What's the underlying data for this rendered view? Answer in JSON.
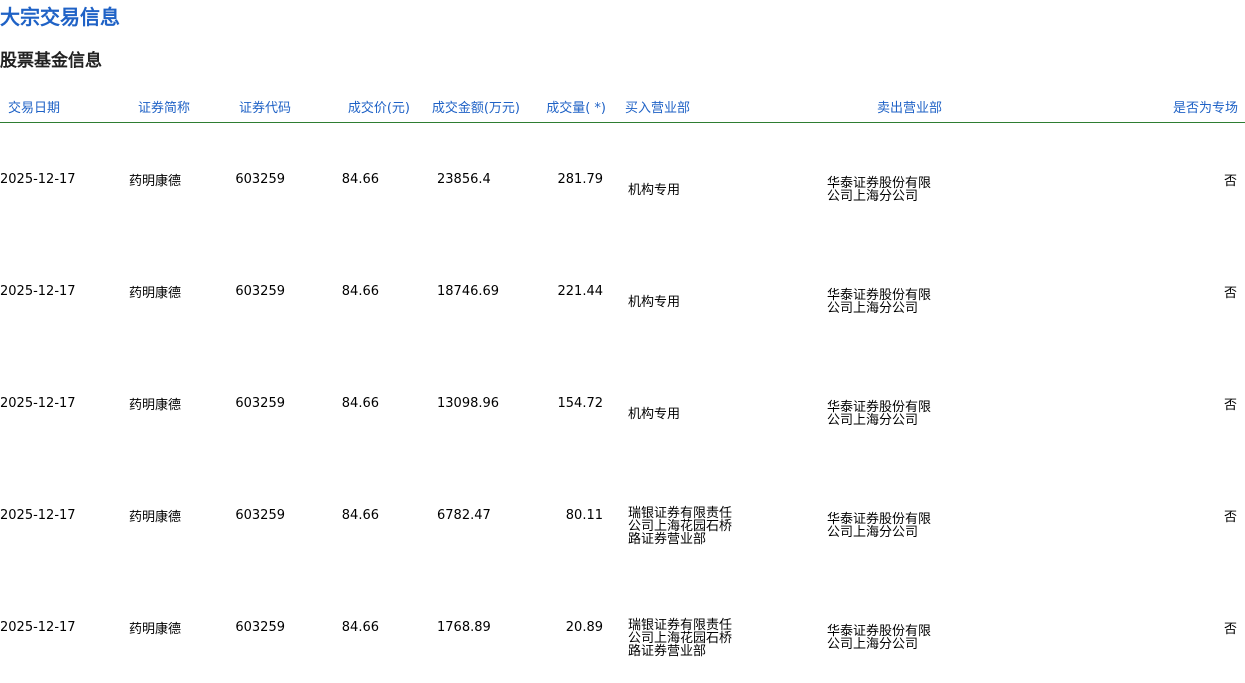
{
  "page": {
    "title": "大宗交易信息",
    "section_title": "股票基金信息"
  },
  "table": {
    "headers": {
      "date": "交易日期",
      "name": "证券简称",
      "code": "证券代码",
      "price": "成交价(元)",
      "amount": "成交金额(万元)",
      "volume": "成交量( *)",
      "buyer": "买入营业部",
      "seller": "卖出营业部",
      "special": "是否为专场"
    },
    "rows": [
      {
        "date": "2025-12-17",
        "name": "药明康德",
        "code": "603259",
        "price": "84.66",
        "amount": "23856.4",
        "volume": "281.79",
        "buyer": "机构专用",
        "seller": "华泰证券股份有限公司上海分公司",
        "special": "否"
      },
      {
        "date": "2025-12-17",
        "name": "药明康德",
        "code": "603259",
        "price": "84.66",
        "amount": "18746.69",
        "volume": "221.44",
        "buyer": "机构专用",
        "seller": "华泰证券股份有限公司上海分公司",
        "special": "否"
      },
      {
        "date": "2025-12-17",
        "name": "药明康德",
        "code": "603259",
        "price": "84.66",
        "amount": "13098.96",
        "volume": "154.72",
        "buyer": "机构专用",
        "seller": "华泰证券股份有限公司上海分公司",
        "special": "否"
      },
      {
        "date": "2025-12-17",
        "name": "药明康德",
        "code": "603259",
        "price": "84.66",
        "amount": "6782.47",
        "volume": "80.11",
        "buyer": "瑞银证券有限责任公司上海花园石桥路证券营业部",
        "seller": "华泰证券股份有限公司上海分公司",
        "special": "否"
      },
      {
        "date": "2025-12-17",
        "name": "药明康德",
        "code": "603259",
        "price": "84.66",
        "amount": "1768.89",
        "volume": "20.89",
        "buyer": "瑞银证券有限责任公司上海花园石桥路证券营业部",
        "seller": "华泰证券股份有限公司上海分公司",
        "special": "否"
      }
    ]
  },
  "colors": {
    "title": "#1f62c6",
    "header_text": "#1f62c6",
    "header_rule": "#2e7d32",
    "body_text": "#000000"
  }
}
